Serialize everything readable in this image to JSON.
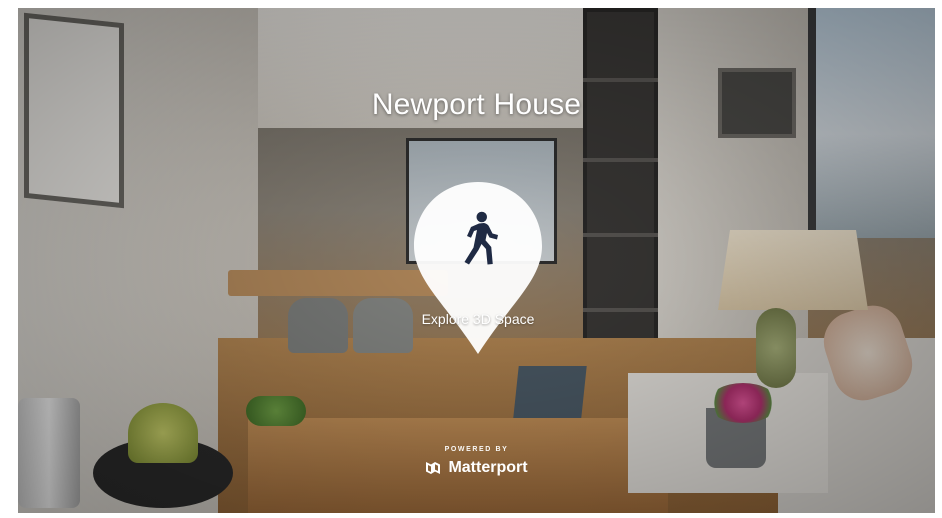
{
  "showcase": {
    "title": "Newport House",
    "cta": {
      "label": "Explore 3D Space",
      "icon": "person-walking-icon"
    },
    "branding": {
      "powered_by": "POWERED BY",
      "brand_name": "Matterport",
      "logo_icon": "matterport-logo-icon"
    }
  },
  "colors": {
    "overlay_text": "#ffffff",
    "pin_fill": "#ffffff",
    "icon_color": "#1f2a44"
  }
}
